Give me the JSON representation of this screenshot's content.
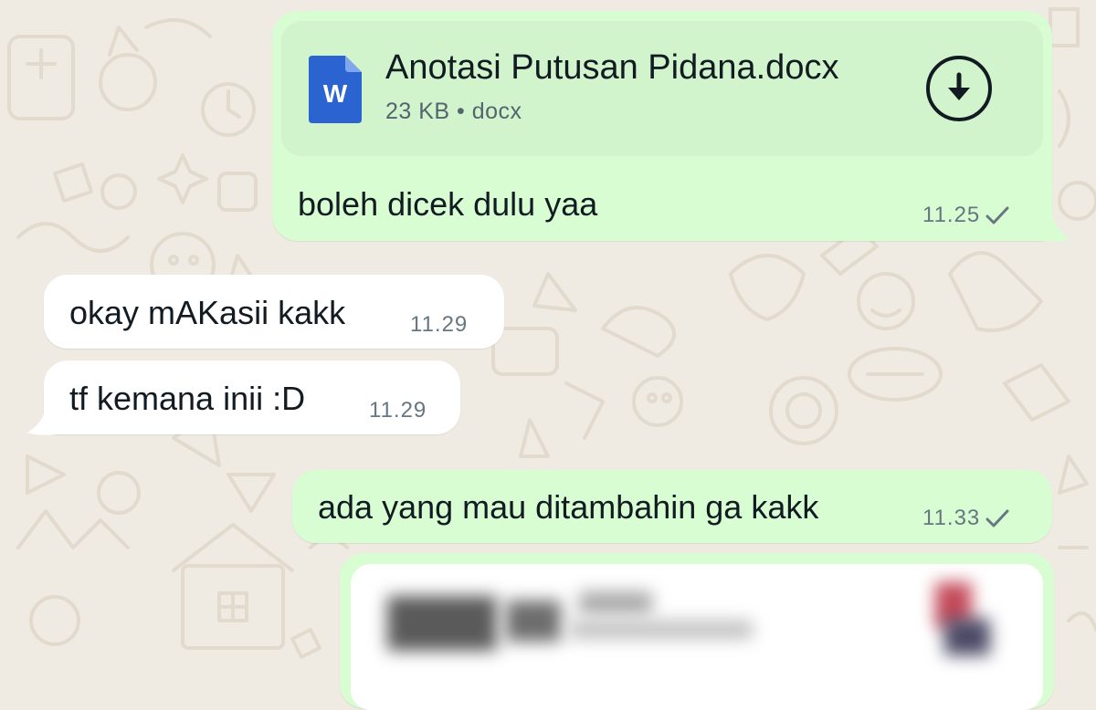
{
  "chat": {
    "messages": [
      {
        "direction": "outgoing",
        "document": {
          "file_name": "Anotasi Putusan Pidana.docx",
          "file_meta": "23 KB • docx",
          "icon_letter": "W",
          "icon": "word-document-icon",
          "action_icon": "download-icon"
        },
        "caption": "boleh dicek dulu yaa",
        "time": "11.25",
        "status_icon": "single-check-icon"
      },
      {
        "direction": "incoming",
        "text": "okay mAKasii kakk",
        "time": "11.29"
      },
      {
        "direction": "incoming",
        "text": "tf kemana inii :D",
        "time": "11.29"
      },
      {
        "direction": "outgoing",
        "text": "ada yang mau ditambahin ga kakk",
        "time": "11.33",
        "status_icon": "single-check-icon"
      },
      {
        "direction": "outgoing",
        "type": "image",
        "blurred": true
      }
    ]
  },
  "colors": {
    "wallpaper": "#efeae2",
    "outgoing_bubble": "#d9fdd3",
    "document_card": "#d1f4cc",
    "incoming_bubble": "#ffffff",
    "word_blue": "#2b63d0",
    "meta_text": "#667781"
  }
}
